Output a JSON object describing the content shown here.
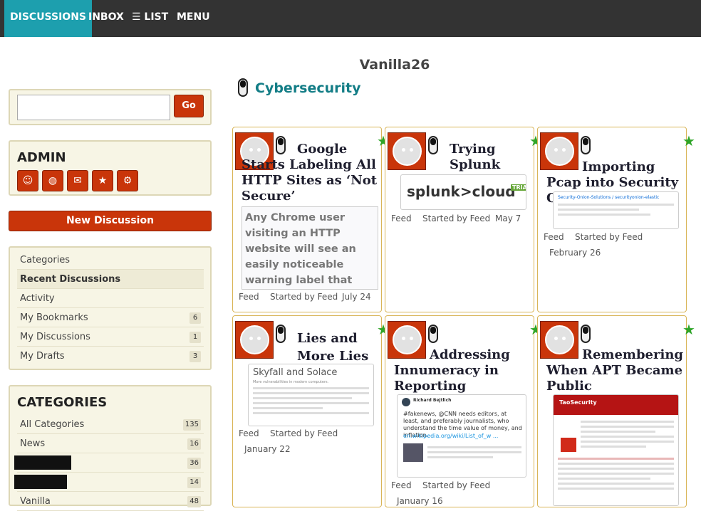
{
  "topnav": {
    "discussions": "DISCUSSIONS",
    "inbox": "INBOX",
    "list": "☰ LIST",
    "menu": "MENU"
  },
  "site_title": "Vanilla26",
  "category_title": "Cybersecurity",
  "search": {
    "value": "",
    "placeholder": "",
    "go_label": "Go"
  },
  "admin": {
    "title": "ADMIN",
    "icons": [
      "user-icon",
      "globe-icon",
      "mail-icon",
      "star-icon",
      "gear-icon"
    ]
  },
  "new_discussion_label": "New Discussion",
  "nav": [
    {
      "label": "Categories",
      "count": ""
    },
    {
      "label": "Recent Discussions",
      "count": ""
    },
    {
      "label": "Activity",
      "count": ""
    },
    {
      "label": "My Bookmarks",
      "count": "6"
    },
    {
      "label": "My Discussions",
      "count": "1"
    },
    {
      "label": "My Drafts",
      "count": "3"
    }
  ],
  "categories": {
    "title": "CATEGORIES",
    "items": [
      {
        "label": "All Categories",
        "count": "135"
      },
      {
        "label": "News",
        "count": "16"
      },
      {
        "label": "",
        "count": "36"
      },
      {
        "label": "",
        "count": "14"
      },
      {
        "label": "Vanilla",
        "count": "48"
      }
    ]
  },
  "cards": [
    {
      "title": "Google Starts Labeling All HTTP Sites as ‘Not Secure’",
      "excerpt": "Any Chrome user visiting an HTTP website will see an easily noticeable warning label that the site is \"not secure.\"",
      "feed": "Feed",
      "started": "Started by Feed",
      "date": "July 24"
    },
    {
      "title": "Trying Splunk Cloud",
      "thumb_text": "splunk>cloud",
      "thumb_badge": "TRIAL",
      "feed": "Feed",
      "started": "Started by Feed",
      "date": "May 7"
    },
    {
      "title": "Importing Pcap into Security Onion",
      "thumb_text": "Security-Onion-Solutions / securityonion-elastic",
      "feed": "Feed",
      "started": "Started by Feed",
      "date": "February 26"
    },
    {
      "title": "Lies and More Lies",
      "thumb_text": "Skyfall and Solace",
      "thumb_sub": "More vulnerabilities in modern computers.",
      "feed": "Feed",
      "started": "Started by Feed",
      "date": "January 22"
    },
    {
      "title": "Addressing Innumeracy in Reporting",
      "thumb_text": "#fakenews, @CNN needs editors, at least, and preferably journalists, who understand the time value of money, and inflation.",
      "thumb_link": "en.wikipedia.org/wiki/List_of_w ...",
      "thumb_author": "Richard Bejtlich",
      "feed": "Feed",
      "started": "Started by Feed",
      "date": "January 16"
    },
    {
      "title": "Remembering When APT Became Public",
      "thumb_text": "TaoSecurity",
      "feed": "Feed",
      "started": "Started by Feed",
      "date": ""
    }
  ],
  "colors": {
    "accent": "#1d9fae",
    "button": "#c9350a",
    "panel": "#f7f5e5",
    "card_border": "#d9b558",
    "category": "#137d86"
  }
}
